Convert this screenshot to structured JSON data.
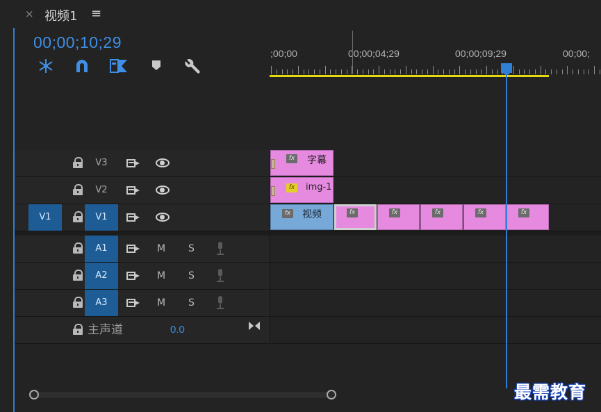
{
  "sequence": {
    "tab_close": "×",
    "tab_title": "视频1",
    "tab_menu": "≡",
    "timecode": "00;00;10;29"
  },
  "tools": [
    {
      "name": "snap-icon",
      "glyph": "⁂"
    },
    {
      "name": "magnet-icon",
      "glyph": "∩"
    },
    {
      "name": "linked-selection-icon",
      "glyph": "◧"
    },
    {
      "name": "marker-icon",
      "glyph": "⬢"
    },
    {
      "name": "wrench-icon",
      "glyph": "🔧"
    }
  ],
  "ruler": {
    "labels": [
      ";00;00",
      "00;00;04;29",
      "00;00;09;29",
      "00;00;"
    ],
    "playhead_time": "00;00;10;29"
  },
  "tracks": {
    "video": [
      {
        "name": "V3",
        "targeted": false,
        "source": ""
      },
      {
        "name": "V2",
        "targeted": false,
        "source": ""
      },
      {
        "name": "V1",
        "targeted": true,
        "source": "V1"
      }
    ],
    "audio": [
      {
        "name": "A1",
        "m": "M",
        "s": "S"
      },
      {
        "name": "A2",
        "m": "M",
        "s": "S"
      },
      {
        "name": "A3",
        "m": "M",
        "s": "S"
      }
    ],
    "master": {
      "label": "主声道",
      "value": "0.0"
    }
  },
  "clips": {
    "v3": {
      "label": "字幕",
      "fx": "fx"
    },
    "v2": {
      "label": "img-1",
      "fx": "fx"
    },
    "v1_video": {
      "label": "视频",
      "fx": "fx"
    },
    "v1_fx": [
      "fx",
      "fx",
      "fx",
      "fx",
      "fx"
    ]
  },
  "colors": {
    "accent": "#2f7fd4",
    "clip_pink": "#e68ae0",
    "clip_blue": "#77a9d8",
    "work_area": "#e6d711"
  },
  "watermark": "最需教育"
}
